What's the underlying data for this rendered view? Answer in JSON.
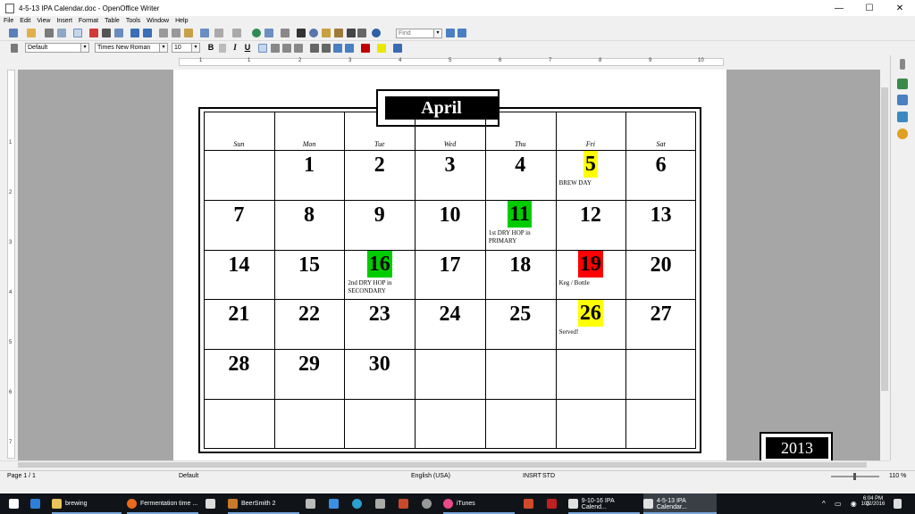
{
  "window": {
    "title": "4-5-13 IPA Calendar.doc - OpenOffice Writer",
    "minimize": "—",
    "maximize": "☐",
    "close": "✕"
  },
  "menu": [
    "File",
    "Edit",
    "View",
    "Insert",
    "Format",
    "Table",
    "Tools",
    "Window",
    "Help"
  ],
  "toolbar": {
    "find_placeholder": "Find"
  },
  "format_bar": {
    "style": "Default",
    "font": "Times New Roman",
    "size": "10",
    "bold": "B",
    "italic": "I",
    "underline": "U"
  },
  "ruler": {
    "marks": [
      "1",
      "1",
      "2",
      "3",
      "4",
      "5",
      "6",
      "7",
      "8",
      "9",
      "10"
    ]
  },
  "vruler": {
    "marks": [
      "1",
      "2",
      "3",
      "4",
      "5",
      "6",
      "7"
    ]
  },
  "calendar": {
    "month": "April",
    "year": "2013",
    "days": [
      "Sun",
      "Mon",
      "Tue",
      "Wed",
      "Thu",
      "Fri",
      "Sat"
    ],
    "weeks": [
      [
        "",
        "1",
        "2",
        "3",
        "4",
        "5",
        "6"
      ],
      [
        "7",
        "8",
        "9",
        "10",
        "11",
        "12",
        "13"
      ],
      [
        "14",
        "15",
        "16",
        "17",
        "18",
        "19",
        "20"
      ],
      [
        "21",
        "22",
        "23",
        "24",
        "25",
        "26",
        "27"
      ],
      [
        "28",
        "29",
        "30",
        "",
        "",
        "",
        ""
      ],
      [
        "",
        "",
        "",
        "",
        "",
        "",
        ""
      ]
    ],
    "highlights": [
      {
        "week": 0,
        "day": 5,
        "color": "#ffff00",
        "note": "BREW DAY"
      },
      {
        "week": 1,
        "day": 4,
        "color": "#00cc00",
        "note": "1st DRY HOP in PRIMARY"
      },
      {
        "week": 2,
        "day": 2,
        "color": "#00cc00",
        "note": "2nd DRY HOP in SECONDARY"
      },
      {
        "week": 2,
        "day": 5,
        "color": "#ff0000",
        "note": "Keg / Bottle"
      },
      {
        "week": 3,
        "day": 5,
        "color": "#ffff00",
        "note": "Served!"
      }
    ]
  },
  "status": {
    "page": "Page 1 / 1",
    "style": "Default",
    "language": "English (USA)",
    "insert": "INSRT",
    "selection": "STD",
    "zoom": "110 %"
  },
  "taskbar": {
    "items": [
      "brewing",
      "Fermentation time ...",
      "BeerSmith 2",
      "iTunes",
      "9-10-16 IPA Calend...",
      "4-5-13 IPA Calendar..."
    ],
    "time": "6:04 PM",
    "date": "10/2/2016"
  }
}
